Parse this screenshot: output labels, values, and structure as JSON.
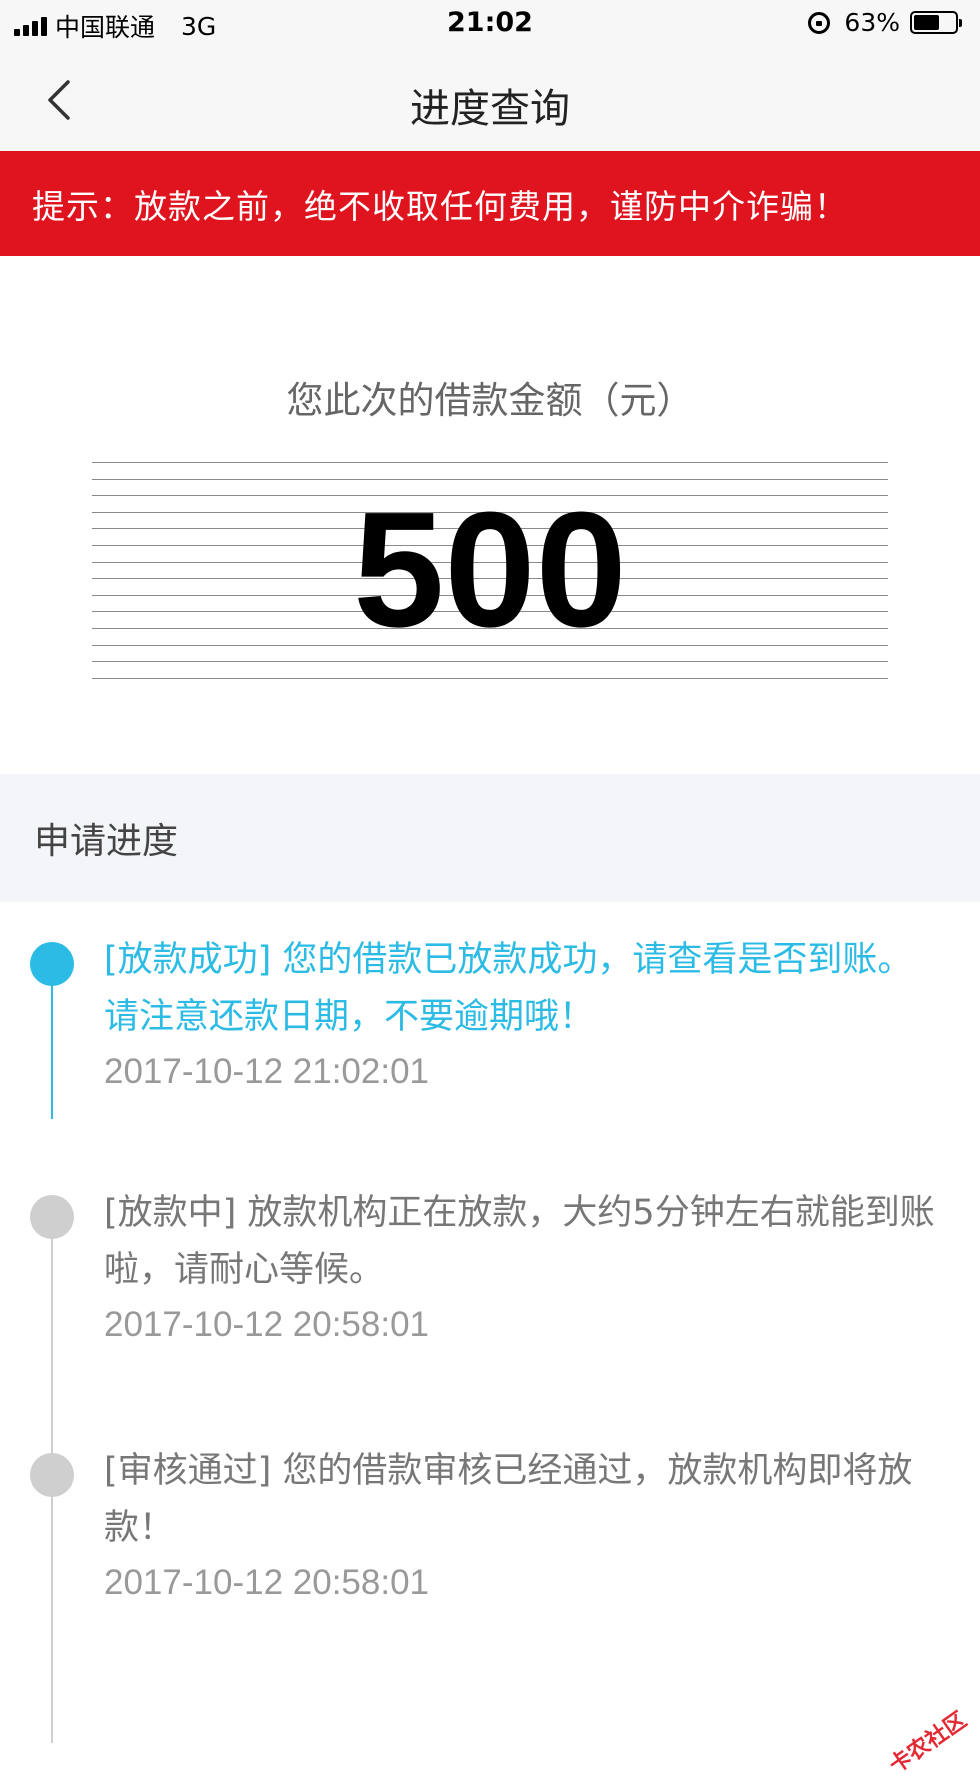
{
  "status_bar": {
    "carrier": "中国联通",
    "network": "3G",
    "time": "21:02",
    "battery_text": "63%",
    "battery_level": 0.63,
    "icons": [
      "signal-icon",
      "orientation-lock-icon",
      "battery-icon"
    ]
  },
  "nav": {
    "title": "进度查询",
    "back_icon": "chevron-left-icon"
  },
  "banner": {
    "text": "提示：放款之前，绝不收取任何费用，谨防中介诈骗！",
    "color": "#e0141f"
  },
  "amount": {
    "label": "您此次的借款金额（元）",
    "value": "500"
  },
  "progress": {
    "title": "申请进度",
    "accent_color": "#2bbbe4",
    "steps": [
      {
        "text": "[放款成功] 您的借款已放款成功，请查看是否到账。请注意还款日期，不要逾期哦！",
        "time": "2017-10-12 21:02:01",
        "active": true
      },
      {
        "text": "[放款中] 放款机构正在放款，大约5分钟左右就能到账啦，请耐心等候。",
        "time": "2017-10-12 20:58:01",
        "active": false
      },
      {
        "text": "[审核通过] 您的借款审核已经通过，放款机构即将放款！",
        "time": "2017-10-12 20:58:01",
        "active": false
      }
    ]
  },
  "watermark": "卡农社区"
}
